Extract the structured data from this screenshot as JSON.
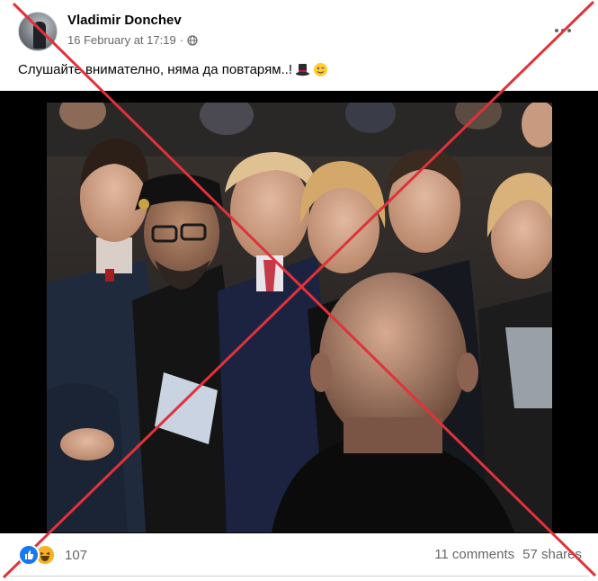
{
  "post": {
    "author": "Vladimir Donchev",
    "timestamp": "16 February at 17:19",
    "separator": "·",
    "audience_icon": "globe-icon",
    "text": "Слушайте внимателно, няма да повтарям..!",
    "emojis": [
      "top-hat-emoji",
      "winking-face-emoji"
    ],
    "more_icon": "ellipsis-icon"
  },
  "footer": {
    "reactions": [
      "like-icon",
      "haha-icon"
    ],
    "reaction_count": "107",
    "comments": "11 comments",
    "shares": "57 shares"
  },
  "overlay": {
    "type": "red-x-cross",
    "color": "#e0323a"
  },
  "colors": {
    "primary_text": "#050505",
    "secondary_text": "#65676b",
    "like_blue": "#1877f2",
    "haha_yellow": "#f7b125",
    "media_background": "#000000"
  }
}
